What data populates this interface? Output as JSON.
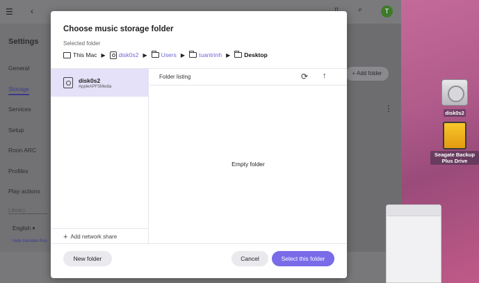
{
  "background_app": {
    "sidebar": {
      "title": "Settings",
      "items": [
        {
          "label": "General"
        },
        {
          "label": "Storage"
        },
        {
          "label": "Services"
        },
        {
          "label": "Setup"
        },
        {
          "label": "Roon ARC"
        },
        {
          "label": "Profiles"
        },
        {
          "label": "Play actions"
        }
      ],
      "library_label": "Library",
      "language_label": "English",
      "help_link": "Help translate Roo"
    },
    "add_folder_label": "Add folder",
    "avatar_initial": "T"
  },
  "desktop": {
    "icons": [
      {
        "label": "disk0s2"
      },
      {
        "label": "Seagate Backup Plus Drive"
      }
    ]
  },
  "dialog": {
    "title": "Choose music storage folder",
    "selected_folder_label": "Selected folder",
    "breadcrumb": [
      {
        "label": "This Mac",
        "icon": "mac-icon"
      },
      {
        "label": "disk0s2",
        "icon": "disk-icon"
      },
      {
        "label": "Users",
        "icon": "folder-icon"
      },
      {
        "label": "tuantrinh",
        "icon": "folder-icon"
      },
      {
        "label": "Desktop",
        "icon": "folder-icon"
      }
    ],
    "volume": {
      "name": "disk0s2",
      "description": "AppleAPFSMedia"
    },
    "add_network_share": "Add network share",
    "listing_title": "Folder listing",
    "empty_text": "Empty folder",
    "buttons": {
      "new_folder": "New folder",
      "cancel": "Cancel",
      "select": "Select this folder"
    }
  }
}
